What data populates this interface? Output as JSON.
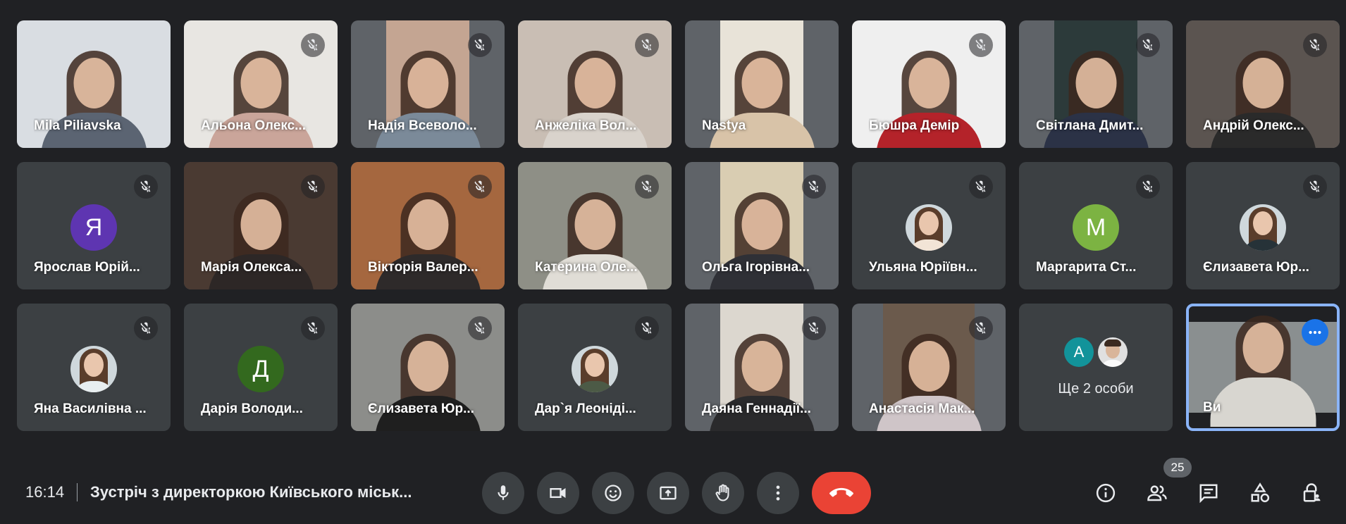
{
  "participants": [
    {
      "name": "Mila Piliavska",
      "type": "video",
      "bg": "#d9dde2",
      "body": "#5b6472",
      "muted": false,
      "width": "full"
    },
    {
      "name": "Альона Олекс...",
      "type": "video",
      "bg": "#e8e6e2",
      "body": "#caa59a",
      "muted": true,
      "width": "full"
    },
    {
      "name": "Надія Всеволо...",
      "type": "video",
      "bg": "#c4a592",
      "body": "#7b8a99",
      "muted": true,
      "width": "narrow"
    },
    {
      "name": "Анжеліка Вол...",
      "type": "video",
      "bg": "#c9beb4",
      "body": "#d9d3cc",
      "muted": true,
      "width": "full"
    },
    {
      "name": "Nastya",
      "type": "video",
      "bg": "#e8e3d8",
      "body": "#d8c3a8",
      "muted": false,
      "width": "narrow"
    },
    {
      "name": "Бюшра Демір",
      "type": "video",
      "bg": "#efefef",
      "body": "#b4232a",
      "muted": true,
      "width": "full"
    },
    {
      "name": "Світлана Дмит...",
      "type": "video",
      "bg": "#2c3a3a",
      "body": "#2b3246",
      "muted": true,
      "width": "narrow"
    },
    {
      "name": "Андрій Олекс...",
      "type": "video",
      "bg": "#5b5450",
      "body": "#2a2a2a",
      "muted": true,
      "width": "full"
    },
    {
      "name": "Ярослав Юрій...",
      "type": "avatar",
      "letter": "Я",
      "color": "#5e35b1",
      "muted": true
    },
    {
      "name": "Марія Олекса...",
      "type": "video",
      "bg": "#4a3a32",
      "body": "#2d2726",
      "muted": true,
      "width": "full"
    },
    {
      "name": "Вікторія Валер...",
      "type": "video",
      "bg": "#a5673f",
      "body": "#2e2a2a",
      "muted": true,
      "width": "full"
    },
    {
      "name": "Катерина Оле...",
      "type": "video",
      "bg": "#8e8f86",
      "body": "#e0ddd6",
      "muted": true,
      "width": "full"
    },
    {
      "name": "Ольга Ігорівна...",
      "type": "video",
      "bg": "#d9cdb2",
      "body": "#2f3036",
      "muted": true,
      "width": "narrow"
    },
    {
      "name": "Ульяна Юріївн...",
      "type": "photo",
      "body": "#f2e4d6",
      "muted": true
    },
    {
      "name": "Маргарита Ст...",
      "type": "avatar",
      "letter": "M",
      "color": "#7cb342",
      "muted": true
    },
    {
      "name": "Єлизавета Юр...",
      "type": "photo",
      "body": "#263238",
      "muted": true
    },
    {
      "name": "Яна Василівна ...",
      "type": "photo",
      "body": "#e8eef0",
      "muted": true
    },
    {
      "name": "Дарія Володи...",
      "type": "avatar",
      "letter": "Д",
      "color": "#33691e",
      "muted": true
    },
    {
      "name": "Єлизавета Юр...",
      "type": "video",
      "bg": "#8c8d8a",
      "body": "#1f1f1f",
      "muted": true,
      "width": "full"
    },
    {
      "name": "Дар`я Леоніді...",
      "type": "photo",
      "body": "#4c5a46",
      "muted": true
    },
    {
      "name": "Даяна Геннадії...",
      "type": "video",
      "bg": "#dcd7cf",
      "body": "#2a2a2c",
      "muted": true,
      "width": "narrow"
    },
    {
      "name": "Анастасія Мак...",
      "type": "video",
      "bg": "#6b5a4c",
      "body": "#cfc5c8",
      "muted": true,
      "width": "med"
    }
  ],
  "more": {
    "label": "Ще 2 особи",
    "avatar_letter": "A",
    "avatar_color": "#12939a"
  },
  "self": {
    "name": "Ви",
    "bg": "#8a8f90",
    "body": "#d8d6d0"
  },
  "bottom_bar": {
    "time": "16:14",
    "meeting_title": "Зустріч з директоркою Київського міськ...",
    "participants_count": "25"
  },
  "icons": {
    "mute": "mic-off-icon",
    "mic": "mic-icon",
    "camera": "videocam-icon",
    "reactions": "emoji-icon",
    "present": "present-screen-icon",
    "raise_hand": "hand-icon",
    "more": "more-vert-icon",
    "hangup": "call-end-icon",
    "info": "info-icon",
    "people": "people-icon",
    "chat": "chat-icon",
    "activities": "activities-icon",
    "host_controls": "lock-person-icon"
  },
  "colors": {
    "background": "#202124",
    "tile": "#3c4043",
    "hangup": "#ea4335",
    "self_border": "#8ab4f8",
    "accent": "#1a73e8"
  }
}
